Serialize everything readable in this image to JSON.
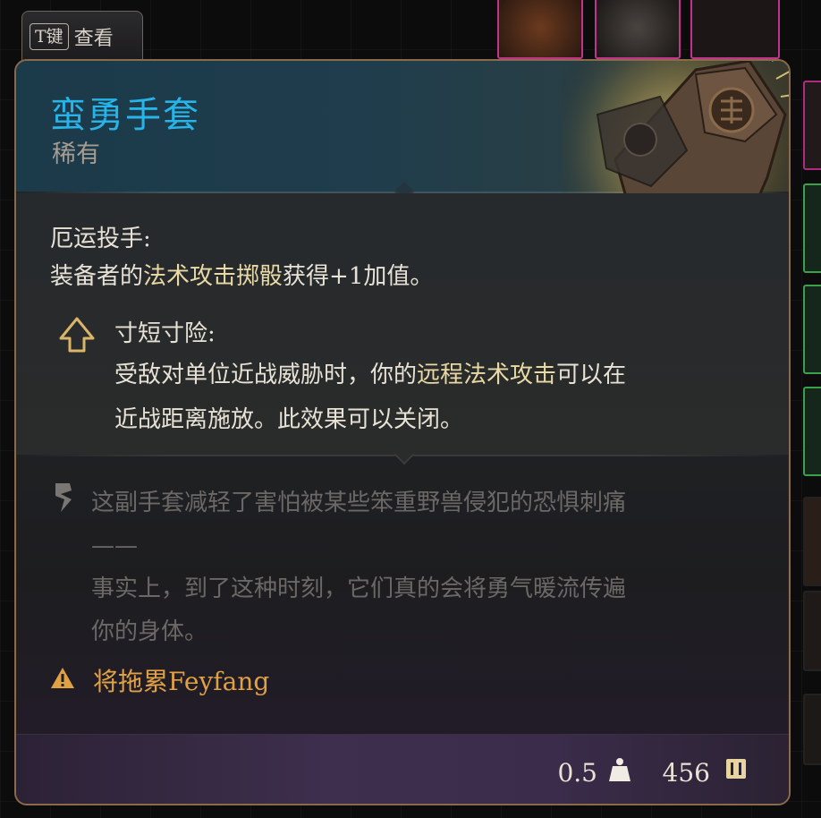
{
  "key_hint": {
    "key": "T键",
    "label": "查看"
  },
  "item": {
    "name": "蛮勇手套",
    "rarity": "稀有",
    "name_color": "#27b4e8"
  },
  "perk": {
    "title": "厄运投手:",
    "desc_prefix": "装备者的",
    "desc_highlight": "法术攻击掷骰",
    "desc_suffix": "获得+1加值。"
  },
  "passive": {
    "icon": "up-arrow-passive-icon",
    "title": "寸短寸险:",
    "line1_prefix": "受敌对单位近战威胁时，你的",
    "line1_highlight": "远程法术攻击",
    "line1_suffix": "可以在",
    "line2": "近战距离施放。此效果可以关闭。"
  },
  "flavor": {
    "icon": "quill-icon",
    "line1": "这副手套减轻了害怕被某些笨重野兽侵犯的恐惧刺痛",
    "line2": "——",
    "line3": "事实上，到了这种时刻，它们真的会将勇气暖流传遍",
    "line4": "你的身体。"
  },
  "warning": {
    "icon": "warning-triangle-icon",
    "text": "将拖累Feyfang",
    "color": "#e0a044"
  },
  "footer": {
    "weight": "0.5",
    "weight_icon": "weight-icon",
    "price": "456",
    "price_icon": "gold-coin-icon"
  }
}
